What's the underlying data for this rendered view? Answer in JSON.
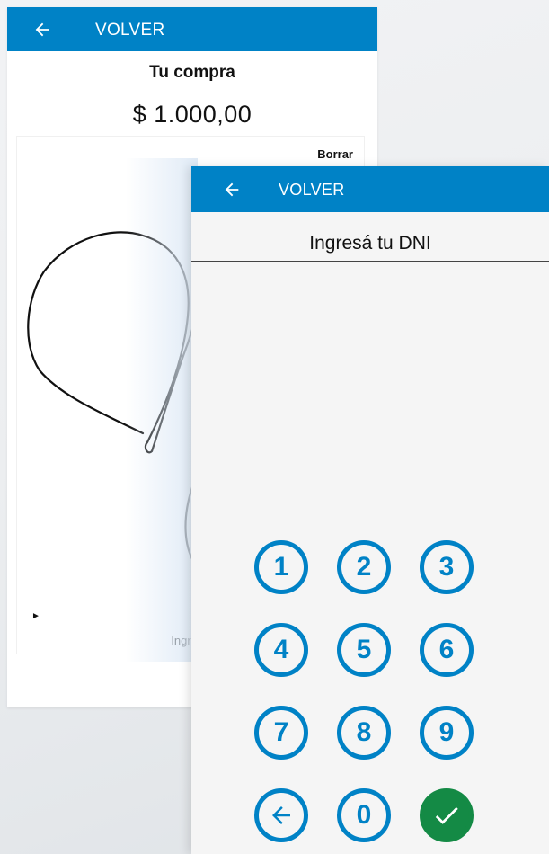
{
  "back_screen": {
    "header": {
      "back_label": "VOLVER",
      "back_icon": "arrow-left-icon"
    },
    "purchase": {
      "title": "Tu compra",
      "amount": "$ 1.000,00"
    },
    "signature": {
      "clear_label": "Borrar",
      "marker": "►",
      "hint": "Ingresá"
    }
  },
  "front_screen": {
    "header": {
      "back_label": "VOLVER",
      "back_icon": "arrow-left-icon"
    },
    "title": "Ingresá tu DNI",
    "keypad": {
      "keys": [
        "1",
        "2",
        "3",
        "4",
        "5",
        "6",
        "7",
        "8",
        "9",
        "",
        "0",
        ""
      ],
      "backspace_icon": "arrow-left-circle-icon",
      "confirm_icon": "check-icon"
    }
  },
  "colors": {
    "brand_blue": "#0082c6",
    "confirm_green": "#148a45",
    "screen_bg": "#f5f5f5"
  }
}
